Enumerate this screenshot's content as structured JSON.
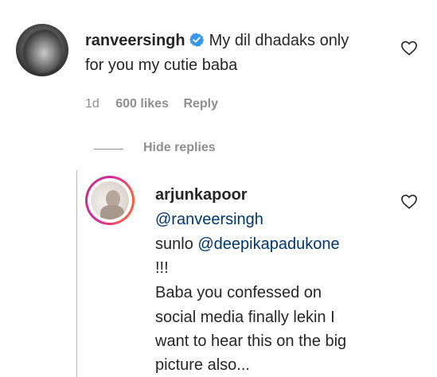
{
  "comment": {
    "username": "ranveersingh",
    "text_line1": "My dil dhadaks only",
    "text_line2": "for you my cutie baba",
    "time": "1d",
    "likes": "600 likes",
    "reply_label": "Reply",
    "hide_replies_label": "Hide replies",
    "verified": true
  },
  "reply": {
    "username": "arjunkapoor",
    "mention1": "@ranveersingh",
    "line2_prefix": "sunlo ",
    "mention2": "@deepikapadukone",
    "line3": "!!!",
    "line4": "Baba you confessed on",
    "line5": "social media finally lekin I",
    "line6": "want to hear this on the big",
    "line7": "picture also..."
  },
  "colors": {
    "text": "#262626",
    "secondary": "#8e8e8e",
    "mention": "#00376b",
    "verified": "#3897f0",
    "story_ring": [
      "#d6249f",
      "#fd5949"
    ]
  },
  "icons": {
    "like_comment": "heart-outline-icon",
    "like_reply": "heart-outline-icon",
    "verified": "verified-badge-icon"
  }
}
